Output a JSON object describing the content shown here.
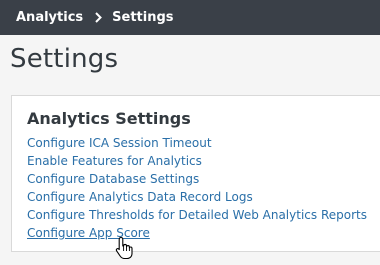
{
  "breadcrumb": {
    "items": [
      "Analytics",
      "Settings"
    ],
    "separator_icon": "chevron-right-icon"
  },
  "page": {
    "title": "Settings"
  },
  "panel": {
    "title": "Analytics Settings",
    "links": [
      "Configure ICA Session Timeout",
      "Enable Features for Analytics",
      "Configure Database Settings",
      "Configure Analytics Data Record Logs",
      "Configure Thresholds for Detailed Web Analytics Reports",
      "Configure App Score"
    ]
  },
  "colors": {
    "topbar": "#3a4048",
    "link": "#2a6fa8",
    "text": "#333a40",
    "background": "#f5f5f5"
  },
  "cursor_icon": "hand-pointer-icon"
}
